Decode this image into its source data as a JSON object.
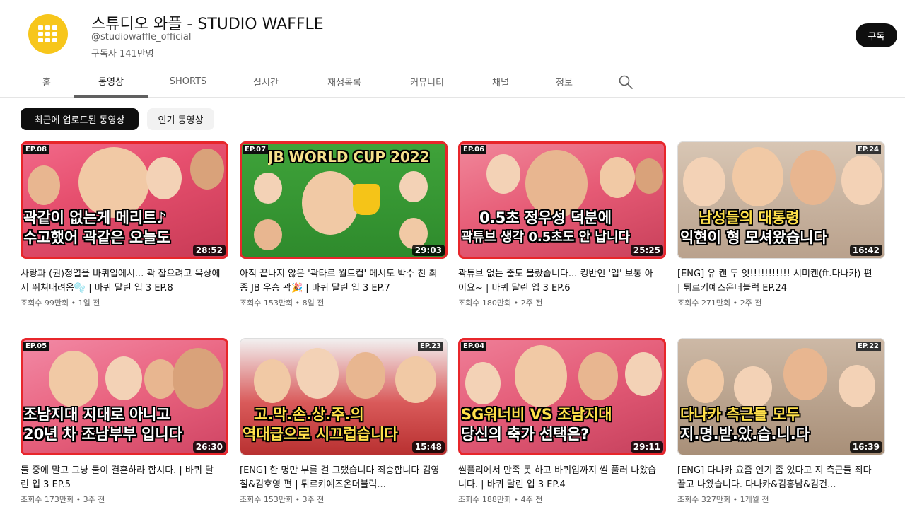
{
  "channel": {
    "title": "스튜디오 와플 - STUDIO WAFFLE",
    "handle": "@studiowaffle_official",
    "subscribers": "구독자 141만명",
    "subscribe_label": "구독",
    "brand_color": "#f7c61b",
    "avatar_icon": "waffle-logo-icon"
  },
  "tabs": [
    {
      "label": "홈",
      "active": false
    },
    {
      "label": "동영상",
      "active": true
    },
    {
      "label": "SHORTS",
      "active": false
    },
    {
      "label": "실시간",
      "active": false
    },
    {
      "label": "재생목록",
      "active": false
    },
    {
      "label": "커뮤니티",
      "active": false
    },
    {
      "label": "채널",
      "active": false
    },
    {
      "label": "정보",
      "active": false
    }
  ],
  "search_icon": "search-icon",
  "chips": [
    {
      "label": "최근에 업로드된 동영상",
      "active": true
    },
    {
      "label": "인기 동영상",
      "active": false
    }
  ],
  "videos": [
    {
      "ep": "EP.08",
      "caption1": "곽같이 없는게 메리트♪",
      "caption2": "수고했어 곽같은 오늘도",
      "duration": "28:52",
      "title": "사랑과 (권)정열을 바퀴입에서... 곽 잡으려고 옥상에서 뛰쳐내려옴🫧 | 바퀴 달린 입 3 EP.8",
      "views": "조회수 99만회",
      "age": "1일 전",
      "accent": "#e8262b"
    },
    {
      "ep": "EP.07",
      "caption1": "JB WORLD CUP 2022",
      "caption2": "",
      "duration": "29:03",
      "title": "아직 끝나지 않은 '곽타르 월드컵' 메시도 박수 친 최종 JB 우승 곽🎉 | 바퀴 달린 입 3 EP.7",
      "views": "조회수 153만회",
      "age": "8일 전",
      "accent": "#e8262b"
    },
    {
      "ep": "EP.06",
      "caption1": "0.5초 정우성 덕분에",
      "caption2": "곽튜브 생각 0.5초도 안 납니다",
      "duration": "25:25",
      "title": "곽튜브 없는 줄도 몰랐습니다... 킹반인 '입' 보통 아이요~ | 바퀴 달린 입 3 EP.6",
      "views": "조회수 180만회",
      "age": "2주 전",
      "accent": "#e8262b"
    },
    {
      "ep": "EP.24",
      "caption1": "남성들의 대통령",
      "caption2": "익현이 형 모셔왔습니다",
      "duration": "16:42",
      "title": "[ENG] 유 캔 두 잇!!!!!!!!!!! 시미켄(ft.다나카) 편 | 튀르키예즈온더블럭 EP.24",
      "views": "조회수 271만회",
      "age": "2주 전",
      "accent": "#dddddd"
    },
    {
      "ep": "EP.05",
      "caption1": "조남지대 지대로 아니고",
      "caption2": "20년 차 조남부부 입니다",
      "duration": "26:30",
      "title": "둘 중에 말고 그냥 둘이 결혼하라 합시다. | 바퀴 달린 입 3 EP.5",
      "views": "조회수 173만회",
      "age": "3주 전",
      "accent": "#e8262b"
    },
    {
      "ep": "EP.23",
      "caption1": "고.막.손.상.주.의",
      "caption2": "역대급으로 시끄럽습니다",
      "duration": "15:48",
      "title": "[ENG] 한 명만 부를 걸 그랬습니다 죄송합니다 김영철&김호영 편 | 튀르키예즈온더블럭...",
      "views": "조회수 153만회",
      "age": "3주 전",
      "accent": "#dddddd"
    },
    {
      "ep": "EP.04",
      "caption1": "SG워너비 VS 조남지대",
      "caption2": "당신의 축가 선택은?",
      "duration": "29:11",
      "title": "썰플리에서 만족 못 하고 바퀴입까지 썰 풀러 나왔습니다. | 바퀴 달린 입 3 EP.4",
      "views": "조회수 188만회",
      "age": "4주 전",
      "accent": "#e8262b"
    },
    {
      "ep": "EP.22",
      "caption1": "다나카 측근들 모두",
      "caption2": "지.명.받.았.습.니.다",
      "duration": "16:39",
      "title": "[ENG] 다나카 요즘 인기 좀 있다고 지 측근들 죄다 끌고 나왔습니다. 다나카&김홍남&김건...",
      "views": "조회수 327만회",
      "age": "1개월 전",
      "accent": "#dddddd"
    }
  ]
}
